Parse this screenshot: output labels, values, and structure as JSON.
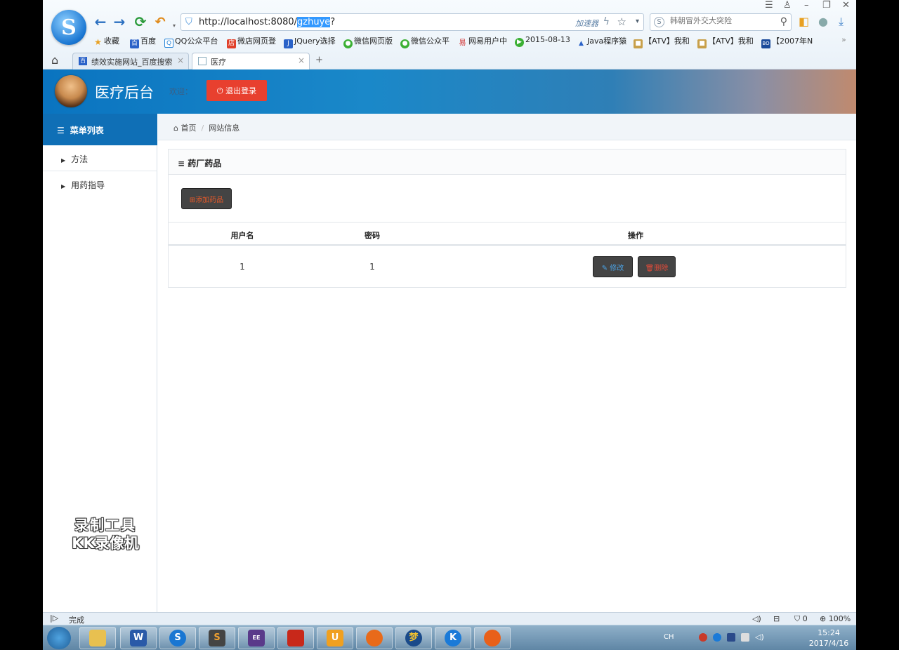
{
  "browser": {
    "url_prefix": "http://localhost:8080/",
    "url_selected": "gzhuye",
    "url_suffix": "?",
    "accelerator_label": "加速器",
    "search_placeholder": "韩朝冒外交大突险",
    "bookmarks": [
      "收藏",
      "百度",
      "QQ公众平台",
      "微店网页登",
      "JQuery选择",
      "微信网页版",
      "微信公众平",
      "网易用户中",
      "2015-08-13",
      "Java程序猿",
      "【ATV】我和",
      "【ATV】我和",
      "【2007年N"
    ],
    "tabs": [
      {
        "label": "绩效实施网站_百度搜索",
        "active": false
      },
      {
        "label": "医疗",
        "active": true
      }
    ]
  },
  "app": {
    "title": "医疗后台",
    "welcome": "欢迎：",
    "logout_label": "退出登录"
  },
  "sidebar": {
    "header": "菜单列表",
    "items": [
      "方法",
      "用药指导"
    ]
  },
  "breadcrumb": {
    "home": "首页",
    "current": "网站信息"
  },
  "panel": {
    "title": "药厂药品",
    "add_button": "添加药品",
    "columns": [
      "用户名",
      "密码",
      "操作"
    ],
    "rows": [
      {
        "username": "1",
        "password": "1",
        "edit_label": "修改",
        "delete_label": "删除"
      }
    ]
  },
  "watermark": {
    "line1": "录制工具",
    "line2": "KK录像机"
  },
  "statusbar": {
    "status": "完成",
    "count": "0",
    "zoom": "100%"
  },
  "taskbar": {
    "lang": "CH",
    "time": "15:24",
    "date": "2017/4/16"
  },
  "colors": {
    "header_blue": "#0a74c0",
    "logout_red": "#e8402f",
    "sidebar_head": "#0f6fb6"
  }
}
